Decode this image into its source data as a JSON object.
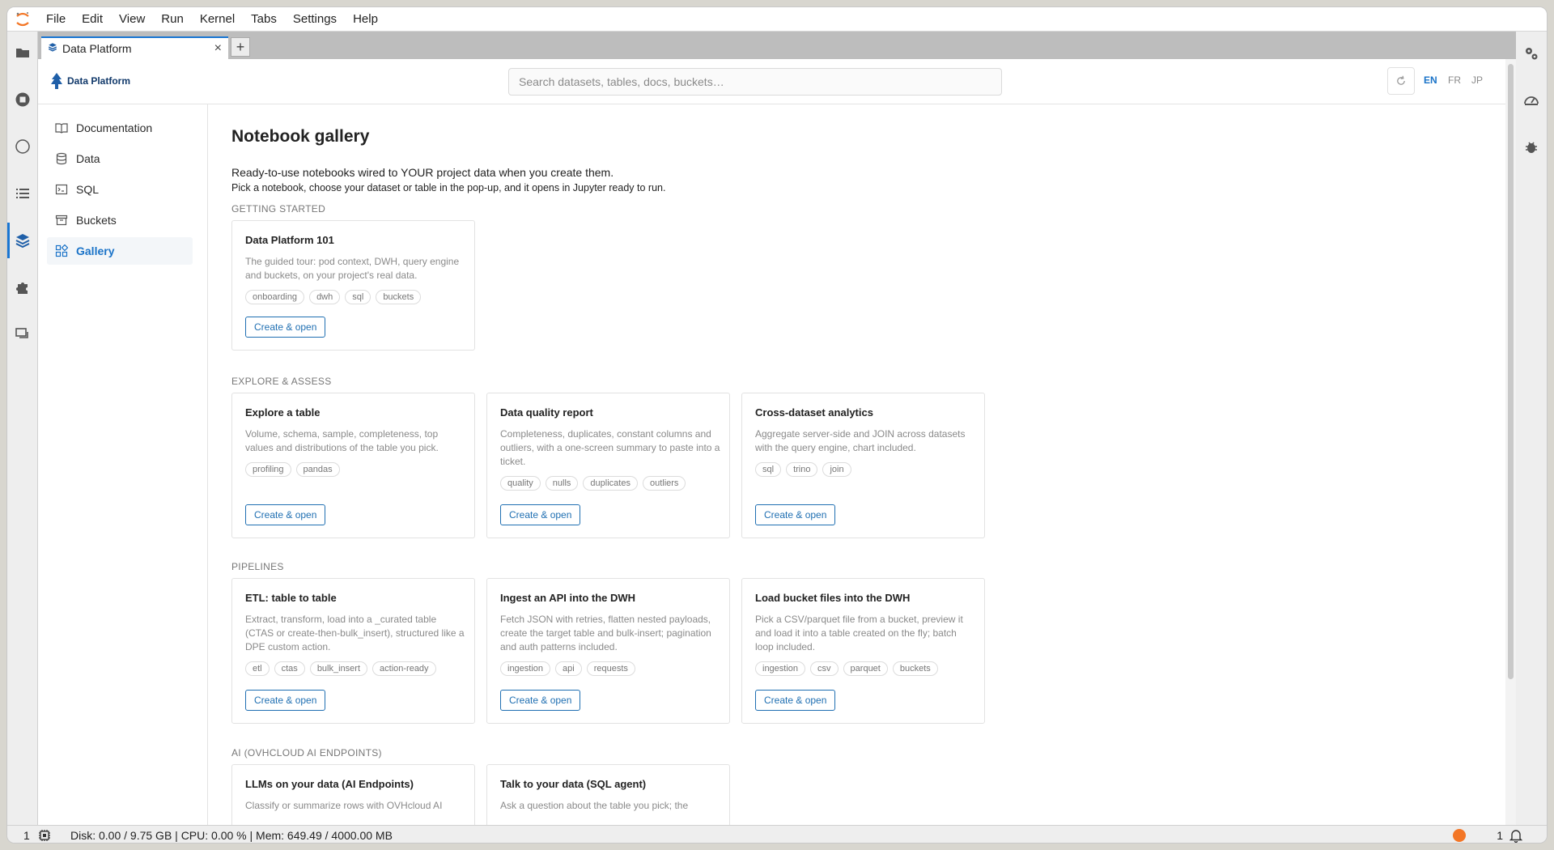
{
  "menubar": {
    "items": [
      "File",
      "Edit",
      "View",
      "Run",
      "Kernel",
      "Tabs",
      "Settings",
      "Help"
    ]
  },
  "tab": {
    "title": "Data Platform",
    "close_label": "×",
    "new_tab_label": "+"
  },
  "topbar": {
    "brand": "Data Platform",
    "search_placeholder": "Search datasets, tables, docs, buckets…",
    "languages": [
      "EN",
      "FR",
      "JP"
    ],
    "active_language": "EN"
  },
  "sidenav": {
    "items": [
      {
        "label": "Documentation",
        "icon": "book-icon"
      },
      {
        "label": "Data",
        "icon": "database-icon"
      },
      {
        "label": "SQL",
        "icon": "terminal-icon"
      },
      {
        "label": "Buckets",
        "icon": "archive-icon"
      },
      {
        "label": "Gallery",
        "icon": "grid-icon",
        "active": true
      }
    ]
  },
  "content": {
    "title": "Notebook gallery",
    "intro1": "Ready-to-use notebooks wired to YOUR project data when you create them.",
    "intro2": "Pick a notebook, choose your dataset or table in the pop-up, and it opens in Jupyter ready to run.",
    "button_label": "Create & open",
    "sections": [
      {
        "label": "GETTING STARTED",
        "cards": [
          {
            "title": "Data Platform 101",
            "desc": "The guided tour: pod context, DWH, query engine and buckets, on your project's real data.",
            "tags": [
              "onboarding",
              "dwh",
              "sql",
              "buckets"
            ]
          }
        ]
      },
      {
        "label": "EXPLORE & ASSESS",
        "cards": [
          {
            "title": "Explore a table",
            "desc": "Volume, schema, sample, completeness, top values and distributions of the table you pick.",
            "tags": [
              "profiling",
              "pandas"
            ]
          },
          {
            "title": "Data quality report",
            "desc": "Completeness, duplicates, constant columns and outliers, with a one-screen summary to paste into a ticket.",
            "tags": [
              "quality",
              "nulls",
              "duplicates",
              "outliers"
            ]
          },
          {
            "title": "Cross-dataset analytics",
            "desc": "Aggregate server-side and JOIN across datasets with the query engine, chart included.",
            "tags": [
              "sql",
              "trino",
              "join"
            ]
          }
        ]
      },
      {
        "label": "PIPELINES",
        "cards": [
          {
            "title": "ETL: table to table",
            "desc": "Extract, transform, load into a _curated table (CTAS or create-then-bulk_insert), structured like a DPE custom action.",
            "tags": [
              "etl",
              "ctas",
              "bulk_insert",
              "action-ready"
            ]
          },
          {
            "title": "Ingest an API into the DWH",
            "desc": "Fetch JSON with retries, flatten nested payloads, create the target table and bulk-insert; pagination and auth patterns included.",
            "tags": [
              "ingestion",
              "api",
              "requests"
            ]
          },
          {
            "title": "Load bucket files into the DWH",
            "desc": "Pick a CSV/parquet file from a bucket, preview it and load it into a table created on the fly; batch loop included.",
            "tags": [
              "ingestion",
              "csv",
              "parquet",
              "buckets"
            ]
          }
        ]
      },
      {
        "label": "AI (OVHCLOUD AI ENDPOINTS)",
        "cards": [
          {
            "title": "LLMs on your data (AI Endpoints)",
            "desc": "Classify or summarize rows with OVHcloud AI",
            "tags": []
          },
          {
            "title": "Talk to your data (SQL agent)",
            "desc": "Ask a question about the table you pick; the",
            "tags": []
          }
        ]
      }
    ]
  },
  "statusbar": {
    "num": "1",
    "metrics": "Disk: 0.00 / 9.75 GB | CPU: 0.00 % | Mem: 649.49 / 4000.00 MB",
    "notifications": "1"
  },
  "colors": {
    "accent": "#1a73c8",
    "brand": "#123a6b",
    "jupyter_orange": "#f37626"
  }
}
